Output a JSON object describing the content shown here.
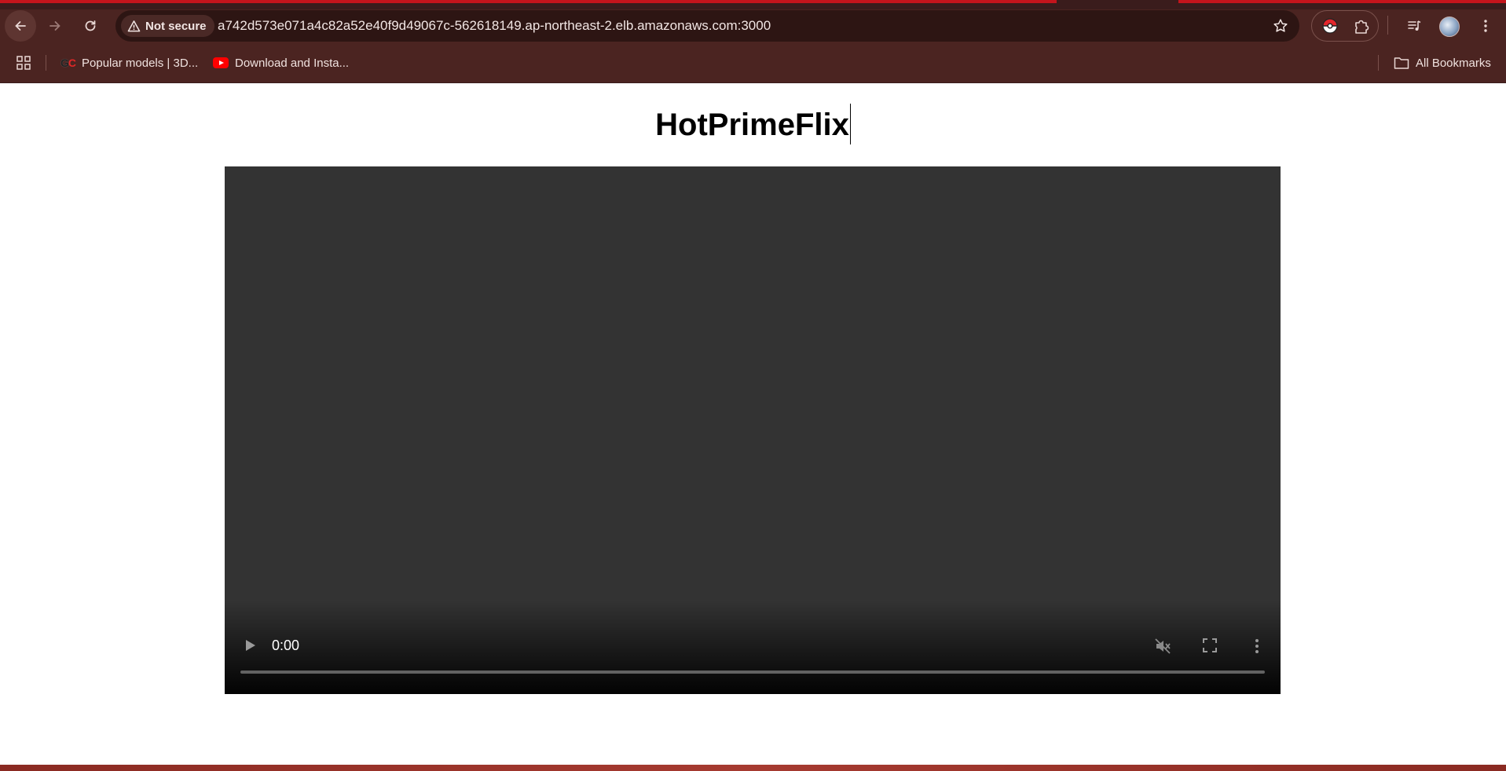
{
  "browser": {
    "security_label": "Not secure",
    "url": "a742d573e071a4c82a52e40f9d49067c-562618149.ap-northeast-2.elb.amazonaws.com:3000",
    "bookmarks": [
      {
        "label": "Popular models | 3D...",
        "icon": "gc-logo"
      },
      {
        "label": "Download and Insta...",
        "icon": "youtube-icon"
      }
    ],
    "all_bookmarks_label": "All Bookmarks"
  },
  "page": {
    "title": "HotPrimeFlix"
  },
  "video": {
    "time": "0:00",
    "progress": 0,
    "muted": true
  },
  "colors": {
    "toolbar": "#4b2421",
    "omnibox": "#2d1513",
    "tab_accent": "#c4141c",
    "video_bg": "#333333"
  }
}
